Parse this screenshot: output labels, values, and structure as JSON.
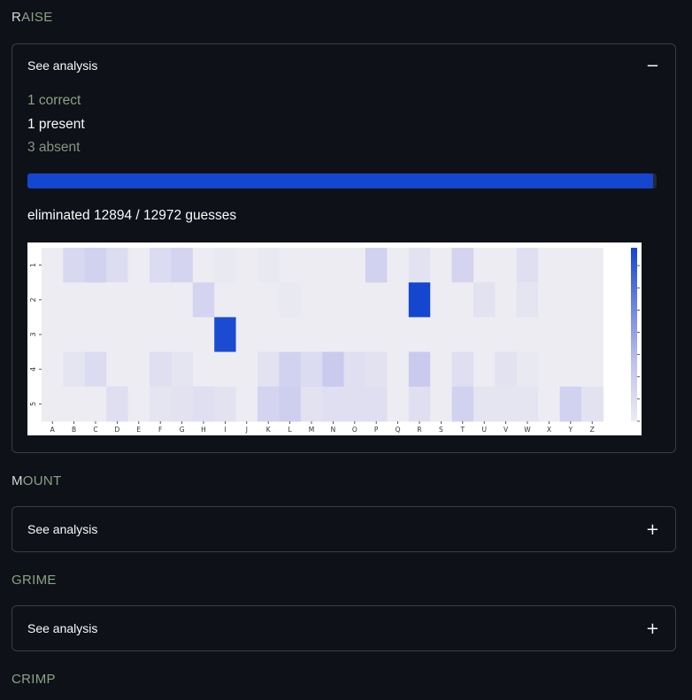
{
  "guesses": [
    {
      "first": "R",
      "rest": "AISE",
      "expanded": true
    },
    {
      "first": "M",
      "rest": "OUNT",
      "expanded": false
    },
    {
      "first": "G",
      "rest": "RIME",
      "expanded": false
    },
    {
      "first": "C",
      "rest": "RIMP",
      "expanded": false
    }
  ],
  "expander": {
    "label": "See analysis",
    "collapse_icon": "−",
    "expand_icon": "+"
  },
  "analysis": {
    "correct": "1 correct",
    "present": "1 present",
    "absent": "3 absent",
    "progress_fraction": 0.994,
    "eliminated": "eliminated 12894 / 12972 guesses"
  },
  "colors": {
    "accent": "#1446d0",
    "correct": "#8aa383",
    "background": "#0e1117"
  },
  "chart_data": {
    "type": "heatmap",
    "x_labels": [
      "A",
      "B",
      "C",
      "D",
      "E",
      "F",
      "G",
      "H",
      "I",
      "J",
      "K",
      "L",
      "M",
      "N",
      "O",
      "P",
      "Q",
      "R",
      "S",
      "T",
      "U",
      "V",
      "W",
      "X",
      "Y",
      "Z"
    ],
    "y_labels": [
      "1",
      "2",
      "3",
      "4",
      "5"
    ],
    "colorbar_ticks": [
      "0",
      "10",
      "20",
      "30",
      "40",
      "50",
      "60",
      "70"
    ],
    "vmin": 0,
    "vmax": 78,
    "values": [
      [
        0,
        12,
        16,
        9,
        0,
        10,
        14,
        0,
        2,
        0,
        2,
        0,
        0,
        0,
        0,
        16,
        0,
        6,
        0,
        14,
        0,
        0,
        8,
        0,
        0,
        0
      ],
      [
        0,
        0,
        0,
        0,
        0,
        0,
        0,
        14,
        0,
        0,
        0,
        2,
        0,
        0,
        0,
        0,
        0,
        78,
        0,
        0,
        6,
        0,
        4,
        0,
        0,
        0
      ],
      [
        0,
        0,
        0,
        0,
        0,
        0,
        0,
        0,
        76,
        0,
        0,
        0,
        0,
        0,
        0,
        0,
        0,
        0,
        0,
        0,
        0,
        0,
        0,
        0,
        0,
        0
      ],
      [
        0,
        4,
        10,
        0,
        0,
        8,
        4,
        0,
        0,
        0,
        6,
        16,
        10,
        20,
        8,
        6,
        0,
        20,
        0,
        8,
        0,
        6,
        2,
        0,
        0,
        0
      ],
      [
        0,
        0,
        0,
        8,
        0,
        4,
        6,
        8,
        6,
        0,
        14,
        18,
        6,
        8,
        8,
        8,
        0,
        8,
        0,
        16,
        4,
        4,
        4,
        0,
        16,
        6
      ]
    ]
  }
}
